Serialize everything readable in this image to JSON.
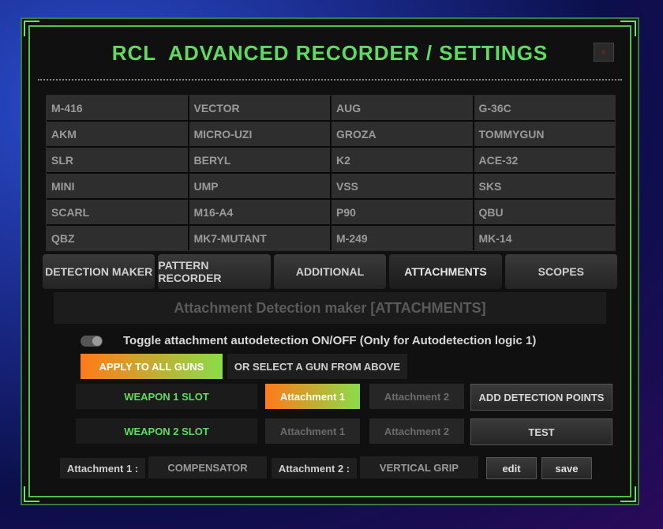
{
  "window": {
    "title": "RCL  ADVANCED RECORDER / SETTINGS",
    "close_label": "×"
  },
  "guns": [
    "M-416",
    "VECTOR",
    "AUG",
    "G-36C",
    "AKM",
    "MICRO-UZI",
    "GROZA",
    "TOMMYGUN",
    "SLR",
    "BERYL",
    "K2",
    "ACE-32",
    "MINI",
    "UMP",
    "VSS",
    "SKS",
    "SCARL",
    "M16-A4",
    "P90",
    "QBU",
    "QBZ",
    "MK7-MUTANT",
    "M-249",
    "MK-14"
  ],
  "tabs": [
    {
      "label": "DETECTION MAKER"
    },
    {
      "label": "PATTERN RECORDER"
    },
    {
      "label": "ADDITIONAL"
    },
    {
      "label": "ATTACHMENTS"
    },
    {
      "label": "SCOPES"
    }
  ],
  "section": {
    "title": "Attachment Detection maker  [ATTACHMENTS]"
  },
  "toggle": {
    "label": "Toggle attachment autodetection ON/OFF (Only for Autodetection logic 1)"
  },
  "buttons": {
    "apply_all": "APPLY TO ALL GUNS",
    "select_gun": "OR SELECT A GUN FROM ABOVE",
    "add_points": "ADD DETECTION POINTS",
    "test": "TEST",
    "edit": "edit",
    "save": "save"
  },
  "slots": {
    "weapon1": "WEAPON 1 SLOT",
    "weapon2": "WEAPON 2 SLOT",
    "attachment1": "Attachment 1",
    "attachment2": "Attachment 2"
  },
  "current": {
    "att1_label": "Attachment 1 :",
    "att1_value": "COMPENSATOR",
    "att2_label": "Attachment 2 :",
    "att2_value": "VERTICAL GRIP"
  },
  "colors": {
    "accent_green": "#5fdc5f",
    "accent_orange": "#ff7a1a"
  }
}
